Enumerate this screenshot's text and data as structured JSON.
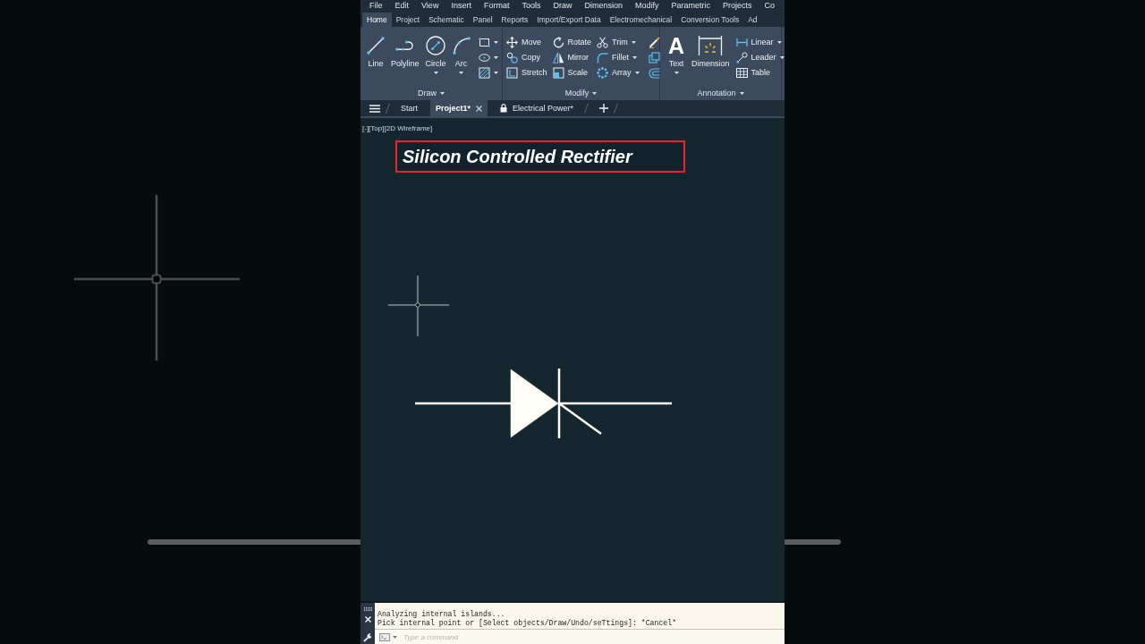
{
  "menu_bar": {
    "items": [
      "File",
      "Edit",
      "View",
      "Insert",
      "Format",
      "Tools",
      "Draw",
      "Dimension",
      "Modify",
      "Parametric",
      "Projects",
      "Co"
    ]
  },
  "ribbon_tabs": [
    {
      "label": "Home",
      "selected": true
    },
    {
      "label": "Project",
      "selected": false
    },
    {
      "label": "Schematic",
      "selected": false
    },
    {
      "label": "Panel",
      "selected": false
    },
    {
      "label": "Reports",
      "selected": false
    },
    {
      "label": "Import/Export Data",
      "selected": false
    },
    {
      "label": "Electromechanical",
      "selected": false
    },
    {
      "label": "Conversion Tools",
      "selected": false
    },
    {
      "label": "Ad",
      "selected": false
    }
  ],
  "ribbon": {
    "draw": {
      "title": "Draw",
      "tools": [
        {
          "label": "Line",
          "has_menu": false
        },
        {
          "label": "Polyline",
          "has_menu": false
        },
        {
          "label": "Circle",
          "has_menu": true
        },
        {
          "label": "Arc",
          "has_menu": true
        }
      ],
      "small_tools": [
        {
          "has_menu": true
        },
        {
          "has_menu": true
        },
        {
          "has_menu": true
        }
      ]
    },
    "modify": {
      "title": "Modify",
      "tools": [
        {
          "label": "Move",
          "has_menu": false
        },
        {
          "label": "Rotate",
          "has_menu": false
        },
        {
          "label": "Trim",
          "has_menu": true
        },
        {
          "label": "Copy",
          "has_menu": false
        },
        {
          "label": "Mirror",
          "has_menu": false
        },
        {
          "label": "Fillet",
          "has_menu": true
        },
        {
          "label": "Stretch",
          "has_menu": false
        },
        {
          "label": "Scale",
          "has_menu": false
        },
        {
          "label": "Array",
          "has_menu": true
        }
      ]
    },
    "annotation": {
      "title": "Annotation",
      "large_tools": [
        {
          "label": "Text",
          "glyph": "A",
          "has_menu": true
        },
        {
          "label": "Dimension",
          "has_menu": false
        }
      ],
      "tools": [
        {
          "label": "Linear",
          "has_menu": true
        },
        {
          "label": "Leader",
          "has_menu": true
        },
        {
          "label": "Table",
          "has_menu": false
        }
      ]
    }
  },
  "file_tabs": [
    {
      "label": "Start",
      "selected": false,
      "closable": false,
      "locked": false
    },
    {
      "label": "Project1*",
      "selected": true,
      "closable": true,
      "locked": false
    },
    {
      "label": "Electrical Power*",
      "selected": false,
      "closable": false,
      "locked": true
    }
  ],
  "viewport": {
    "controls": [
      "[-]",
      "[Top]",
      "[2D Wireframe]"
    ],
    "title_banner": "Silicon Controlled Rectifier"
  },
  "command_line": {
    "history": [
      "Analyzing internal islands...",
      "Pick internal point or [Select objects/Draw/Undo/seTtings]: *Cancel*"
    ],
    "input": {
      "placeholder": "Type a command"
    }
  }
}
